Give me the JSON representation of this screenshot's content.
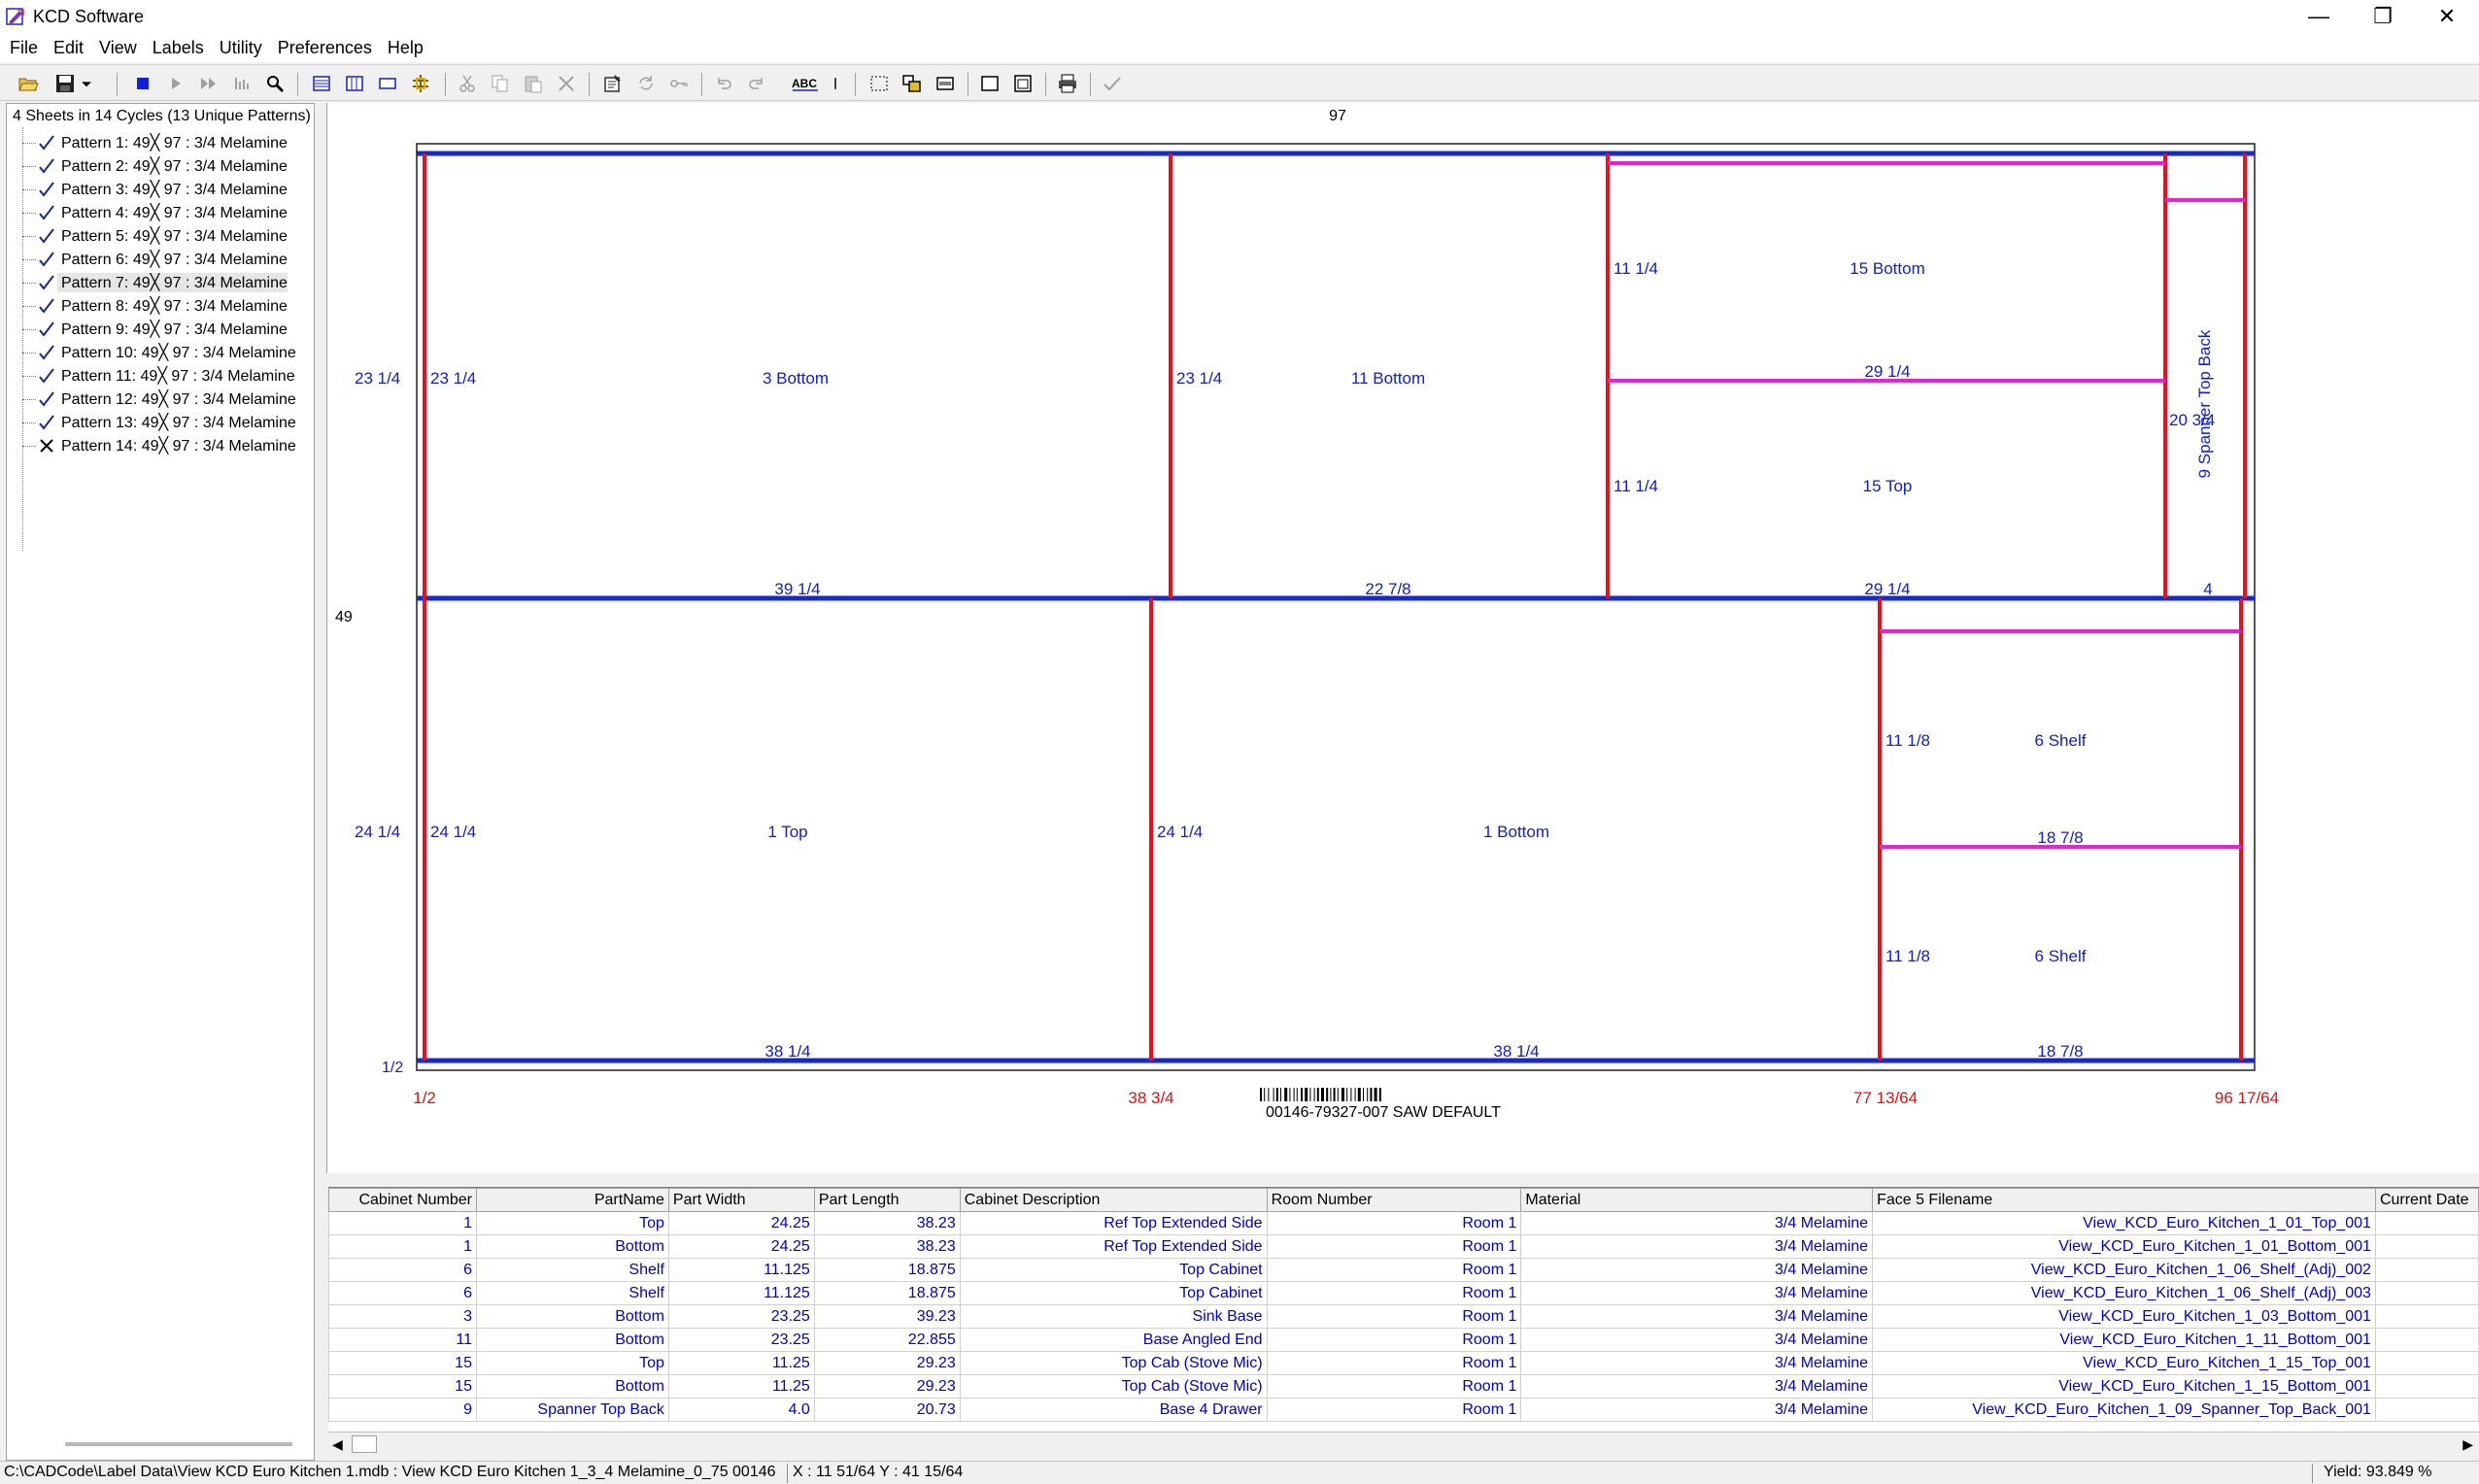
{
  "window": {
    "title": "KCD Software",
    "minimize_glyph": "—",
    "restore_glyph": "❐",
    "close_glyph": "✕"
  },
  "menu": [
    "File",
    "Edit",
    "View",
    "Labels",
    "Utility",
    "Preferences",
    "Help"
  ],
  "toolbar_icons": [
    "open-folder-icon",
    "save-icon",
    "dropdown-icon",
    "stop-icon",
    "play-icon",
    "fast-forward-icon",
    "step-icon",
    "zoom-icon",
    "list-view-icon",
    "column-view-icon",
    "panel-view-icon",
    "crosshair-icon",
    "cut-icon",
    "copy-icon",
    "paste-icon",
    "delete-icon",
    "properties-icon",
    "refresh-icon",
    "key-icon",
    "undo-icon",
    "redo-icon",
    "abc-icon",
    "separator-icon",
    "select-icon",
    "arrange-icon",
    "panel-icon",
    "rectangle-icon",
    "window-icon",
    "print-icon",
    "check-icon"
  ],
  "tree": {
    "root_label": "4 Sheets in 14 Cycles (13 Unique Patterns)",
    "items": [
      {
        "label": "Pattern 1:  49╳ 97 : 3/4 Melamine",
        "status": "check"
      },
      {
        "label": "Pattern 2:  49╳ 97 : 3/4 Melamine",
        "status": "check"
      },
      {
        "label": "Pattern 3:  49╳ 97 : 3/4 Melamine",
        "status": "check"
      },
      {
        "label": "Pattern 4:  49╳ 97 : 3/4 Melamine",
        "status": "check"
      },
      {
        "label": "Pattern 5:  49╳ 97 : 3/4 Melamine",
        "status": "check"
      },
      {
        "label": "Pattern 6:  49╳ 97 : 3/4 Melamine",
        "status": "check"
      },
      {
        "label": "Pattern 7:  49╳ 97 : 3/4 Melamine",
        "status": "check",
        "selected": true
      },
      {
        "label": "Pattern 8:  49╳ 97 : 3/4 Melamine",
        "status": "check"
      },
      {
        "label": "Pattern 9:  49╳ 97 : 3/4 Melamine",
        "status": "check"
      },
      {
        "label": "Pattern 10:  49╳ 97 : 3/4 Melamine",
        "status": "check"
      },
      {
        "label": "Pattern 11:  49╳ 97 : 3/4 Melamine",
        "status": "check"
      },
      {
        "label": "Pattern 12:  49╳ 97 : 3/4 Melamine",
        "status": "check"
      },
      {
        "label": "Pattern 13:  49╳ 97 : 3/4 Melamine",
        "status": "check"
      },
      {
        "label": "Pattern 14:  49╳ 97 : 3/4 Melamine",
        "status": "cross"
      }
    ]
  },
  "sheet": {
    "width_label": "97",
    "height_label": "49",
    "corner_label": "1/2",
    "colors": {
      "saw_cut": "#e8101c",
      "rip_cut": "#1428d8",
      "sub_cut": "#f01cd8",
      "label": "#1020c8",
      "red_label": "#e01010"
    },
    "top_row_labels": {
      "left_height_outer": "23  1/4",
      "part_3_height": "23  1/4",
      "part_3_name": "3 Bottom",
      "part_3_width": "39  1/4",
      "part_11_height": "23  1/4",
      "part_11_name": "11 Bottom",
      "part_11_width": "22  7/8",
      "part_15b_height": "11  1/4",
      "part_15b_name": "15 Bottom",
      "part_15_mid_width": "29  1/4",
      "part_15t_height": "11  1/4",
      "part_15t_name": "15 Top",
      "part_15_width": "29  1/4",
      "part_9_height": "20  3/4",
      "part_9_name": "9 Spanner Top Back",
      "part_9_width": "4"
    },
    "bottom_row_labels": {
      "left_height_outer": "24  1/4",
      "part_1t_height": "24  1/4",
      "part_1t_name": "1 Top",
      "part_1t_width": "38  1/4",
      "part_1b_height": "24  1/4",
      "part_1b_name": "1 Bottom",
      "part_1b_width": "38  1/4",
      "shelf_a_height": "11  1/8",
      "shelf_a_name": "6 Shelf",
      "shelf_mid_width": "18  7/8",
      "shelf_b_height": "11  1/8",
      "shelf_b_name": "6 Shelf",
      "shelf_width": "18  7/8"
    },
    "cut_positions": [
      "1/2",
      "38  3/4",
      "77 13/64",
      "96 17/64"
    ],
    "barcode_text": "00146-79327-007 SAW DEFAULT"
  },
  "grid": {
    "columns": [
      "Cabinet Number",
      "PartName",
      "Part Width",
      "Part Length",
      "Cabinet Description",
      "Room Number",
      "Material",
      "Face 5 Filename",
      "Current Date"
    ],
    "rows": [
      [
        "1",
        "Top",
        "24.25",
        "38.23",
        "Ref Top Extended Side",
        "Room 1",
        "3/4 Melamine",
        "View_KCD_Euro_Kitchen_1_01_Top_001",
        ""
      ],
      [
        "1",
        "Bottom",
        "24.25",
        "38.23",
        "Ref Top Extended Side",
        "Room 1",
        "3/4 Melamine",
        "View_KCD_Euro_Kitchen_1_01_Bottom_001",
        ""
      ],
      [
        "6",
        "Shelf",
        "11.125",
        "18.875",
        "Top Cabinet",
        "Room 1",
        "3/4 Melamine",
        "View_KCD_Euro_Kitchen_1_06_Shelf_(Adj)_002",
        ""
      ],
      [
        "6",
        "Shelf",
        "11.125",
        "18.875",
        "Top Cabinet",
        "Room 1",
        "3/4 Melamine",
        "View_KCD_Euro_Kitchen_1_06_Shelf_(Adj)_003",
        ""
      ],
      [
        "3",
        "Bottom",
        "23.25",
        "39.23",
        "Sink Base",
        "Room 1",
        "3/4 Melamine",
        "View_KCD_Euro_Kitchen_1_03_Bottom_001",
        ""
      ],
      [
        "11",
        "Bottom",
        "23.25",
        "22.855",
        "Base Angled End",
        "Room 1",
        "3/4 Melamine",
        "View_KCD_Euro_Kitchen_1_11_Bottom_001",
        ""
      ],
      [
        "15",
        "Top",
        "11.25",
        "29.23",
        "Top Cab (Stove Mic)",
        "Room 1",
        "3/4 Melamine",
        "View_KCD_Euro_Kitchen_1_15_Top_001",
        ""
      ],
      [
        "15",
        "Bottom",
        "11.25",
        "29.23",
        "Top Cab (Stove Mic)",
        "Room 1",
        "3/4 Melamine",
        "View_KCD_Euro_Kitchen_1_15_Bottom_001",
        ""
      ],
      [
        "9",
        "Spanner Top Back",
        "4.0",
        "20.73",
        "Base 4 Drawer",
        "Room 1",
        "3/4 Melamine",
        "View_KCD_Euro_Kitchen_1_09_Spanner_Top_Back_001",
        ""
      ]
    ]
  },
  "status": {
    "path": "C:\\CADCode\\Label Data\\View KCD Euro Kitchen 1.mdb : View KCD Euro Kitchen 1_3_4 Melamine_0_75 00146",
    "coords": "X : 11 51/64 Y : 41 15/64",
    "yield": "Yield: 93.849 %"
  }
}
